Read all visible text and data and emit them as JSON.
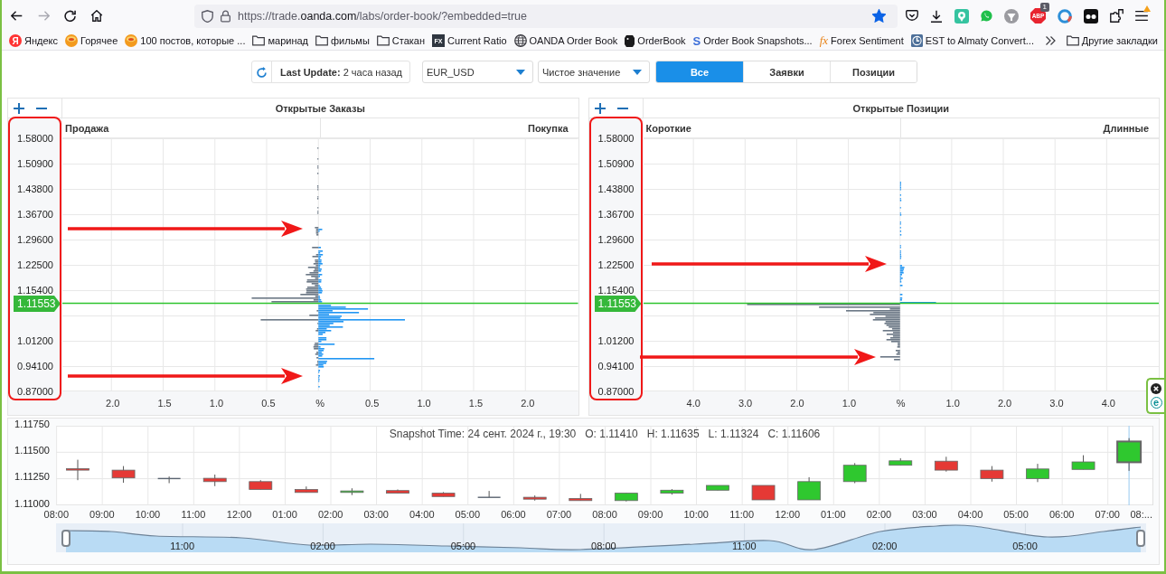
{
  "browser": {
    "nav": [
      {
        "kind": "back",
        "disabled": false
      },
      {
        "kind": "forward",
        "disabled": true
      },
      {
        "kind": "reload",
        "disabled": false
      },
      {
        "kind": "home",
        "disabled": false
      }
    ],
    "url": "https://trade.**oanda.com**/labs/order-book/?embedded=true",
    "bookmarked": true,
    "extension_logo": "ABP",
    "extension_count": "1",
    "menu_alert": true
  },
  "bookmarks": {
    "items": [
      {
        "label": "Яндекс",
        "kind": "site",
        "logo": "Я"
      },
      {
        "label": "Горячее",
        "kind": "site"
      },
      {
        "label": "100 постов, которые ...",
        "kind": "site"
      },
      {
        "label": "маринад",
        "kind": "folder"
      },
      {
        "label": "фильмы",
        "kind": "folder"
      },
      {
        "label": "Стакан",
        "kind": "folder"
      },
      {
        "label": "Current Ratio",
        "kind": "site",
        "logo": "FX"
      },
      {
        "label": "OANDA Order Book",
        "kind": "site"
      },
      {
        "label": "OrderBook",
        "kind": "site"
      },
      {
        "label": "Order Book Snapshots...",
        "kind": "site",
        "logo": "S"
      },
      {
        "label": "Forex Sentiment",
        "kind": "site",
        "logo": "fx"
      },
      {
        "label": "EST to Almaty Convert...",
        "kind": "site"
      }
    ],
    "other": "Другие закладки"
  },
  "controls": {
    "last_update": "**Last Update:** 2 часа назад",
    "instrument": "EUR_USD",
    "mode": "Чистое значение",
    "tabs": [
      {
        "label": "Все",
        "selected": true
      },
      {
        "label": "Заявки",
        "selected": false
      },
      {
        "label": "Позиции",
        "selected": false
      }
    ]
  },
  "panels": [
    {
      "title": "Открытые Заказы",
      "left_label": "Продажа",
      "right_label": "Покупка",
      "price_labels": [
        "1.58000",
        "1.50900",
        "1.43800",
        "1.36700",
        "1.29600",
        "1.22500",
        "1.15400",
        "1.01200",
        "0.94100",
        "0.87000"
      ],
      "current_price": "1.11553",
      "x_labels": [
        "2.0",
        "1.5",
        "1.0",
        "0.5",
        "%",
        "0.5",
        "1.0",
        "1.5",
        "2.0"
      ]
    },
    {
      "title": "Открытые Позиции",
      "left_label": "Короткие",
      "right_label": "Длинные",
      "price_labels": [
        "1.58000",
        "1.50900",
        "1.43800",
        "1.36700",
        "1.29600",
        "1.22500",
        "1.15400",
        "1.01200",
        "0.94100",
        "0.87000"
      ],
      "current_price": "1.11553",
      "x_labels": [
        "4.0",
        "3.0",
        "2.0",
        "1.0",
        "%",
        "1.0",
        "2.0",
        "3.0",
        "4.0"
      ]
    }
  ],
  "snapshot": {
    "time": "Snapshot Time: 24 сент. 2024 г., 19:30",
    "ohlc": [
      "O: 1.11410",
      "H: 1.11635",
      "L: 1.11324",
      "C: 1.11606"
    ],
    "price_labels": [
      "1.11750",
      "1.11500",
      "1.11250",
      "1.11000"
    ],
    "time_labels": [
      "08:00",
      "09:00",
      "10:00",
      "11:00",
      "12:00",
      "01:00",
      "02:00",
      "03:00",
      "04:00",
      "05:00",
      "06:00",
      "07:00",
      "08:00",
      "09:00",
      "10:00",
      "11:00",
      "12:00",
      "01:00",
      "02:00",
      "03:00",
      "04:00",
      "05:00",
      "06:00",
      "07:00",
      "08:..."
    ],
    "navigator_labels": [
      "11:00",
      "02:00",
      "05:00",
      "08:00",
      "11:00",
      "02:00",
      "05:00"
    ]
  },
  "side_widget": {
    "logo": "e"
  }
}
